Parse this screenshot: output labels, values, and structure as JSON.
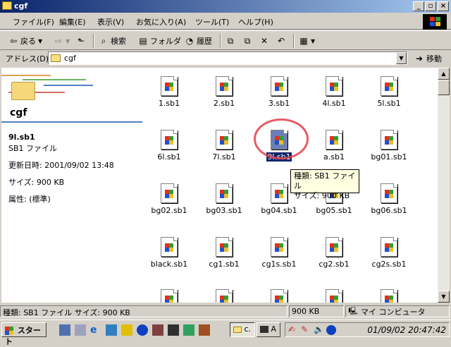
{
  "window": {
    "title": "cgf",
    "min": "_",
    "max": "▫",
    "close": "×"
  },
  "menu": [
    "ファイル(F)",
    "編集(E)",
    "表示(V)",
    "お気に入り(A)",
    "ツール(T)",
    "ヘルプ(H)"
  ],
  "toolbar": {
    "back": "戻る",
    "search": "検索",
    "folders": "フォルダ",
    "history": "履歴"
  },
  "address": {
    "label": "アドレス(D)",
    "value": "cgf",
    "go": "移動"
  },
  "left_panel": {
    "folder_title": "cgf",
    "file_name": "9l.sb1",
    "file_type": "SB1 ファイル",
    "modified": "更新日時: 2001/09/02 13:48",
    "size": "サイズ: 900 KB",
    "attributes": "属性: (標準)"
  },
  "files": [
    {
      "name": "1.sb1"
    },
    {
      "name": "2.sb1"
    },
    {
      "name": "3.sb1"
    },
    {
      "name": "4l.sb1"
    },
    {
      "name": "5l.sb1"
    },
    {
      "name": "6l.sb1"
    },
    {
      "name": "7l.sb1"
    },
    {
      "name": "9l.sb1",
      "selected": true
    },
    {
      "name": "a.sb1"
    },
    {
      "name": "bg01.sb1"
    },
    {
      "name": "bg02.sb1"
    },
    {
      "name": "bg03.sb1"
    },
    {
      "name": "bg04.sb1"
    },
    {
      "name": "bg05.sb1"
    },
    {
      "name": "bg06.sb1"
    },
    {
      "name": "black.sb1"
    },
    {
      "name": "cg1.sb1"
    },
    {
      "name": "cg1s.sb1"
    },
    {
      "name": "cg2.sb1"
    },
    {
      "name": "cg2s.sb1"
    },
    {
      "name": ""
    },
    {
      "name": ""
    },
    {
      "name": ""
    },
    {
      "name": ""
    },
    {
      "name": ""
    }
  ],
  "tooltip": {
    "line1": "種類: SB1 ファイル",
    "line2": "サイズ: 900 KB"
  },
  "status": {
    "left": "種類: SB1 ファイル サイズ: 900 KB",
    "size": "900 KB",
    "zone": "マイ コンピュータ"
  },
  "taskbar": {
    "start": "スタート",
    "task1": "c.",
    "task2": "A",
    "clock": "01/09/02 20:47:42"
  }
}
